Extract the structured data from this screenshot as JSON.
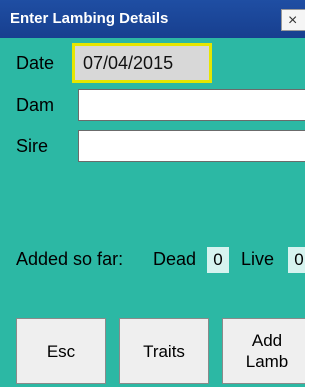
{
  "window": {
    "title": "Enter Lambing Details",
    "close_glyph": "×"
  },
  "form": {
    "date_label": "Date",
    "date_value": "07/04/2015",
    "dam_label": "Dam",
    "dam_value": "",
    "sire_label": "Sire",
    "sire_value": ""
  },
  "summary": {
    "added_label": "Added so far:",
    "dead_label": "Dead",
    "dead_count": "0",
    "live_label": "Live",
    "live_count": "0"
  },
  "buttons": {
    "esc": "Esc",
    "traits": "Traits",
    "add_lamb_line1": "Add",
    "add_lamb_line2": "Lamb"
  },
  "colors": {
    "background": "#2cb8a4",
    "titlebar": "#1f4ea3",
    "date_highlight": "#e6e600"
  }
}
